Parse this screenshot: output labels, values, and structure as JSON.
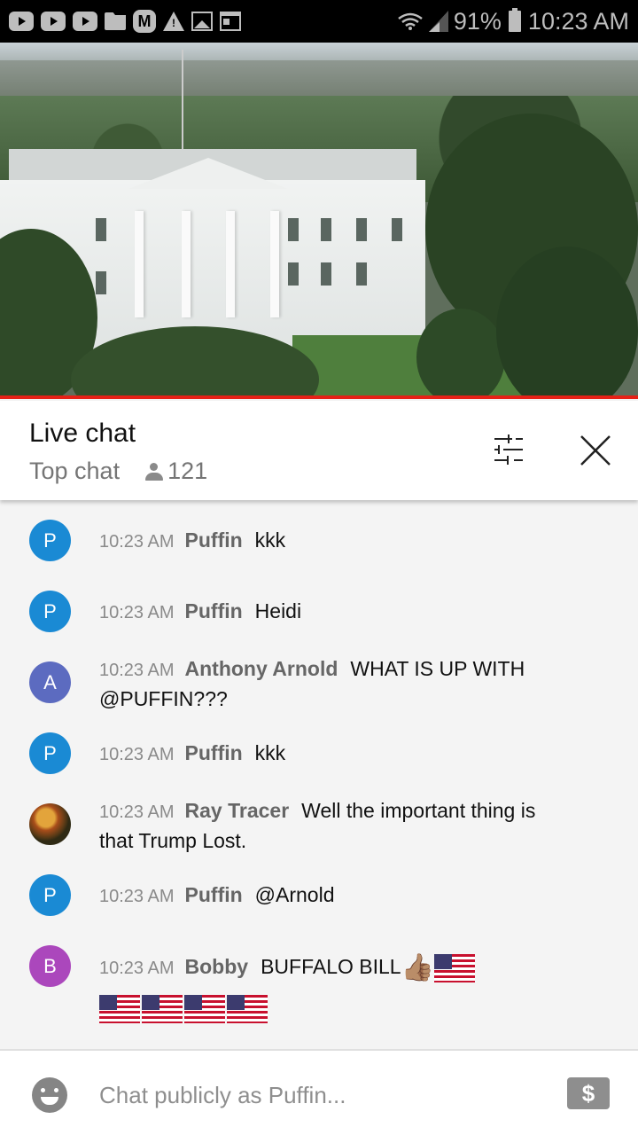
{
  "status_bar": {
    "notification_icons": [
      "youtube-icon",
      "youtube-icon",
      "youtube-icon",
      "folder-icon",
      "m-app-icon",
      "warning-icon",
      "image-icon",
      "news-icon"
    ],
    "battery_percent": "91%",
    "time": "10:23 AM"
  },
  "video": {
    "description": "Live camera view of the White House north lawn"
  },
  "chat_header": {
    "title": "Live chat",
    "mode": "Top chat",
    "viewer_count": "121"
  },
  "messages": [
    {
      "avatar_letter": "P",
      "avatar_color": "#1a8ad4",
      "time": "10:23 AM",
      "author": "Puffin",
      "text": "kkk"
    },
    {
      "avatar_letter": "P",
      "avatar_color": "#1a8ad4",
      "time": "10:23 AM",
      "author": "Puffin",
      "text": "Heidi"
    },
    {
      "avatar_letter": "A",
      "avatar_color": "#5c6bc0",
      "time": "10:23 AM",
      "author": "Anthony Arnold",
      "text": "WHAT IS UP WITH @PUFFIN???"
    },
    {
      "avatar_letter": "P",
      "avatar_color": "#1a8ad4",
      "time": "10:23 AM",
      "author": "Puffin",
      "text": "kkk"
    },
    {
      "avatar_letter": "",
      "avatar_color": "",
      "time": "10:23 AM",
      "author": "Ray Tracer",
      "text": "Well the important thing is that Trump Lost."
    },
    {
      "avatar_letter": "P",
      "avatar_color": "#1a8ad4",
      "time": "10:23 AM",
      "author": "Puffin",
      "text": "@Arnold"
    },
    {
      "avatar_letter": "B",
      "avatar_color": "#ab47bc",
      "time": "10:23 AM",
      "author": "Bobby",
      "text": "BUFFALO BILL",
      "emojis": [
        "thumbs-up-medium-skin",
        "us-flag",
        "us-flag",
        "us-flag",
        "us-flag",
        "us-flag"
      ]
    }
  ],
  "input_bar": {
    "placeholder": "Chat publicly as Puffin...",
    "superchat_symbol": "$"
  },
  "colors": {
    "accent_red": "#e62117"
  }
}
